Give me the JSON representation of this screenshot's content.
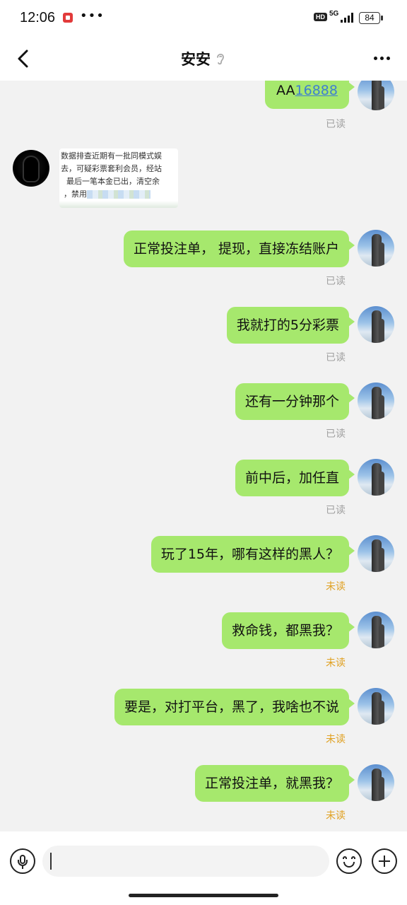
{
  "status_bar": {
    "time": "12:06",
    "dots": "•••",
    "hd": "HD",
    "network": "5G",
    "battery": "84"
  },
  "header": {
    "title": "安安",
    "back_icon": "chevron-left-icon",
    "ear_icon": "ear-icon",
    "more_icon": "more-dots-icon"
  },
  "messages": [
    {
      "side": "right",
      "prefix": "AA",
      "link": "16888",
      "status": "已读"
    },
    {
      "side": "left",
      "type": "image",
      "lines": [
        "数据排查近期有一批同模式娱",
        "去，可疑彩票套利会员，经站",
        "最后一笔本金已出，清空余",
        "，禁用"
      ]
    },
    {
      "side": "right",
      "text": "正常投注单，  提现，直接冻结账户",
      "status": "已读"
    },
    {
      "side": "right",
      "text": "我就打的5分彩票",
      "status": "已读"
    },
    {
      "side": "right",
      "text": "还有一分钟那个",
      "status": "已读"
    },
    {
      "side": "right",
      "text": "前中后，加任直",
      "status": "已读"
    },
    {
      "side": "right",
      "text": "玩了15年，哪有这样的黑人？",
      "status": "未读"
    },
    {
      "side": "right",
      "text": "救命钱，都黑我？",
      "status": "未读"
    },
    {
      "side": "right",
      "text": "要是，对打平台，黑了，我啥也不说",
      "status": "未读"
    },
    {
      "side": "right",
      "text": "正常投注单，就黑我？",
      "status": "未读"
    }
  ],
  "colors": {
    "bubble": "#a6e86d",
    "read": "#a0a0a0",
    "unread": "#e0a020",
    "link": "#3f7fd0"
  },
  "input_bar": {
    "mic_icon": "microphone-icon",
    "emoji_icon": "emoji-icon",
    "add_icon": "plus-icon"
  }
}
